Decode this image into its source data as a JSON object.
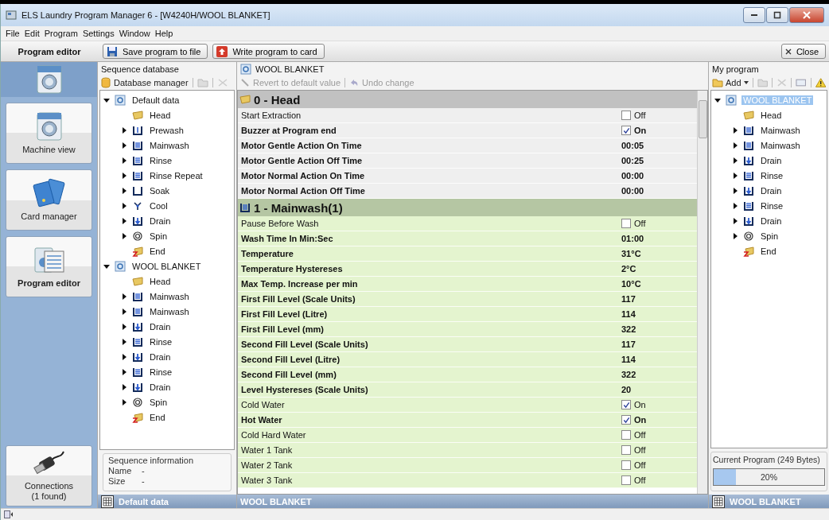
{
  "window": {
    "title": "ELS Laundry Program Manager 6 - [W4240H/WOOL BLANKET]"
  },
  "menu": [
    "File",
    "Edit",
    "Program",
    "Settings",
    "Window",
    "Help"
  ],
  "toolbar": {
    "section_label": "Program editor",
    "buttons": [
      {
        "label": "Save program to file",
        "kind": "save"
      },
      {
        "label": "Write program to card",
        "kind": "write"
      }
    ],
    "close_label": "Close"
  },
  "nav": [
    {
      "label": "Machine view",
      "kind": "machine",
      "selected": false
    },
    {
      "label": "Card manager",
      "kind": "cards",
      "selected": false
    },
    {
      "label": "Program editor",
      "kind": "editor",
      "selected": true
    }
  ],
  "connections": {
    "label": "Connections\n(1 found)"
  },
  "sequence_database": {
    "title": "Sequence database",
    "toolbar_label": "Database manager",
    "tree": [
      {
        "label": "Default data",
        "kind": "program",
        "expanded": true,
        "selected": false,
        "children": [
          {
            "label": "Head",
            "kind": "head",
            "selected": false
          },
          {
            "label": "Prewash",
            "kind": "prewash",
            "expanded": false,
            "selected": false
          },
          {
            "label": "Mainwash",
            "kind": "mainwash",
            "expanded": false,
            "selected": false
          },
          {
            "label": "Rinse",
            "kind": "rinse",
            "expanded": false,
            "selected": false
          },
          {
            "label": "Rinse Repeat",
            "kind": "rinse",
            "expanded": false,
            "selected": false
          },
          {
            "label": "Soak",
            "kind": "soak",
            "expanded": false,
            "selected": false
          },
          {
            "label": "Cool",
            "kind": "cool",
            "expanded": false,
            "selected": false
          },
          {
            "label": "Drain",
            "kind": "drain",
            "expanded": false,
            "selected": false
          },
          {
            "label": "Spin",
            "kind": "spin",
            "expanded": false,
            "selected": false
          },
          {
            "label": "End",
            "kind": "end",
            "selected": false
          }
        ]
      },
      {
        "label": "WOOL BLANKET",
        "kind": "program",
        "expanded": true,
        "selected": false,
        "children": [
          {
            "label": "Head",
            "kind": "head",
            "selected": false
          },
          {
            "label": "Mainwash",
            "kind": "mainwash",
            "expanded": false,
            "selected": false
          },
          {
            "label": "Mainwash",
            "kind": "mainwash",
            "expanded": false,
            "selected": false
          },
          {
            "label": "Drain",
            "kind": "drain",
            "expanded": false,
            "selected": false
          },
          {
            "label": "Rinse",
            "kind": "rinse",
            "expanded": false,
            "selected": false
          },
          {
            "label": "Drain",
            "kind": "drain",
            "expanded": false,
            "selected": false
          },
          {
            "label": "Rinse",
            "kind": "rinse",
            "expanded": false,
            "selected": false
          },
          {
            "label": "Drain",
            "kind": "drain",
            "expanded": false,
            "selected": false
          },
          {
            "label": "Spin",
            "kind": "spin",
            "expanded": false,
            "selected": false
          },
          {
            "label": "End",
            "kind": "end",
            "selected": false
          }
        ]
      }
    ],
    "info": {
      "title": "Sequence information",
      "fields": [
        {
          "label": "Name",
          "value": "-"
        },
        {
          "label": "Size",
          "value": "-"
        }
      ]
    },
    "footer": "Default data"
  },
  "editor": {
    "title": "WOOL BLANKET",
    "actions": [
      {
        "label": "Revert to default value",
        "kind": "revert",
        "disabled": true
      },
      {
        "label": "Undo change",
        "kind": "undo",
        "disabled": true
      }
    ],
    "sections": [
      {
        "title": "0 - Head",
        "kind": "head",
        "rows": [
          {
            "label": "Start Extraction",
            "modified": false,
            "kind": "check",
            "checked": false,
            "value": "Off"
          },
          {
            "label": "Buzzer at Program end",
            "modified": true,
            "kind": "check",
            "checked": true,
            "value": "On"
          },
          {
            "label": "Motor Gentle Action On Time",
            "modified": true,
            "kind": "value",
            "value": "00:05"
          },
          {
            "label": "Motor Gentle Action Off Time",
            "modified": true,
            "kind": "value",
            "value": "00:25"
          },
          {
            "label": "Motor Normal Action On Time",
            "modified": true,
            "kind": "value",
            "value": "00:00"
          },
          {
            "label": "Motor Normal Action Off Time",
            "modified": true,
            "kind": "value",
            "value": "00:00"
          }
        ]
      },
      {
        "title": "1 - Mainwash(1)",
        "kind": "mainwash",
        "rows": [
          {
            "label": "Pause Before Wash",
            "modified": false,
            "kind": "check",
            "checked": false,
            "value": "Off"
          },
          {
            "label": "Wash Time In Min:Sec",
            "modified": true,
            "kind": "value",
            "value": "01:00"
          },
          {
            "label": "Temperature",
            "modified": true,
            "kind": "value",
            "value": "31°C"
          },
          {
            "label": "Temperature Hystereses",
            "modified": true,
            "kind": "value",
            "value": "2°C"
          },
          {
            "label": "Max Temp. Increase per min",
            "modified": true,
            "kind": "value",
            "value": "10°C"
          },
          {
            "label": "First Fill Level (Scale Units)",
            "modified": true,
            "kind": "value",
            "value": "117"
          },
          {
            "label": "First Fill Level (Litre)",
            "modified": true,
            "kind": "value",
            "value": "114"
          },
          {
            "label": "First Fill Level (mm)",
            "modified": true,
            "kind": "value",
            "value": "322"
          },
          {
            "label": "Second Fill Level (Scale Units)",
            "modified": true,
            "kind": "value",
            "value": "117"
          },
          {
            "label": "Second Fill Level (Litre)",
            "modified": true,
            "kind": "value",
            "value": "114"
          },
          {
            "label": "Second Fill Level (mm)",
            "modified": true,
            "kind": "value",
            "value": "322"
          },
          {
            "label": "Level Hystereses (Scale Units)",
            "modified": true,
            "kind": "value",
            "value": "20"
          },
          {
            "label": "Cold Water",
            "modified": false,
            "kind": "check",
            "checked": true,
            "value": "On"
          },
          {
            "label": "Hot Water",
            "modified": true,
            "kind": "check",
            "checked": true,
            "value": "On"
          },
          {
            "label": "Cold Hard Water",
            "modified": false,
            "kind": "check",
            "checked": false,
            "value": "Off"
          },
          {
            "label": "Water 1 Tank",
            "modified": false,
            "kind": "check",
            "checked": false,
            "value": "Off"
          },
          {
            "label": "Water 2 Tank",
            "modified": false,
            "kind": "check",
            "checked": false,
            "value": "Off"
          },
          {
            "label": "Water 3 Tank",
            "modified": false,
            "kind": "check",
            "checked": false,
            "value": "Off"
          }
        ]
      }
    ],
    "footer": "WOOL BLANKET"
  },
  "my_program": {
    "title": "My program",
    "add_label": "Add",
    "tree": [
      {
        "label": "WOOL BLANKET",
        "kind": "program",
        "expanded": true,
        "selected": true,
        "children": [
          {
            "label": "Head",
            "kind": "head",
            "selected": false
          },
          {
            "label": "Mainwash",
            "kind": "mainwash",
            "expanded": false,
            "selected": false
          },
          {
            "label": "Mainwash",
            "kind": "mainwash",
            "expanded": false,
            "selected": false
          },
          {
            "label": "Drain",
            "kind": "drain",
            "expanded": false,
            "selected": false
          },
          {
            "label": "Rinse",
            "kind": "rinse",
            "expanded": false,
            "selected": false
          },
          {
            "label": "Drain",
            "kind": "drain",
            "expanded": false,
            "selected": false
          },
          {
            "label": "Rinse",
            "kind": "rinse",
            "expanded": false,
            "selected": false
          },
          {
            "label": "Drain",
            "kind": "drain",
            "expanded": false,
            "selected": false
          },
          {
            "label": "Spin",
            "kind": "spin",
            "expanded": false,
            "selected": false
          },
          {
            "label": "End",
            "kind": "end",
            "selected": false
          }
        ]
      }
    ],
    "usage": {
      "title": "Current Program (249 Bytes)",
      "level": 0.2,
      "reading": "20%"
    },
    "footer": "WOOL BLANKET"
  }
}
